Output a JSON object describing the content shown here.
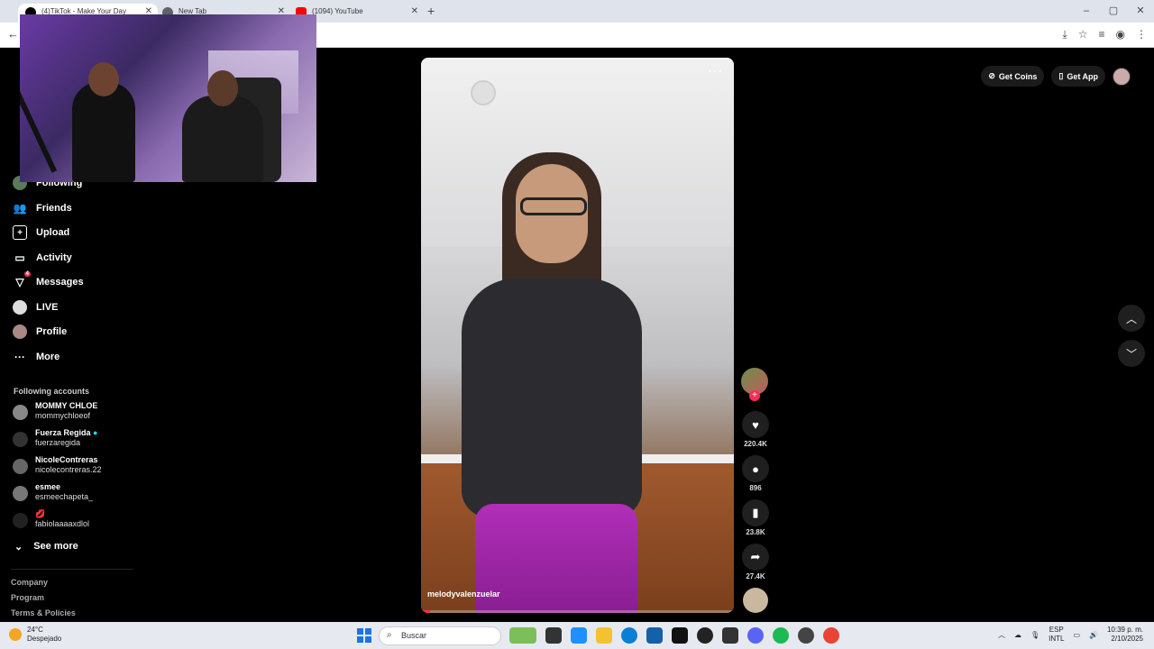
{
  "browser": {
    "tabs": [
      {
        "title": "(4)TikTok - Make Your Day",
        "active": true,
        "favicon_color": "#000000"
      },
      {
        "title": "New Tab",
        "active": false,
        "favicon_color": "#5f6368"
      },
      {
        "title": "(1094) YouTube",
        "active": false,
        "favicon_color": "#ff0000"
      }
    ],
    "new_tab_label": "+",
    "window_controls": [
      "–",
      "▢",
      "✕"
    ]
  },
  "sidebar": {
    "items": [
      {
        "label": "Following",
        "icon": "following-icon"
      },
      {
        "label": "Friends",
        "icon": "friends-icon"
      },
      {
        "label": "Upload",
        "icon": "upload-icon"
      },
      {
        "label": "Activity",
        "icon": "activity-icon"
      },
      {
        "label": "Messages",
        "icon": "messages-icon",
        "badge": "4"
      },
      {
        "label": "LIVE",
        "icon": "live-icon"
      },
      {
        "label": "Profile",
        "icon": "profile-icon"
      },
      {
        "label": "More",
        "icon": "more-icon"
      }
    ],
    "following_title": "Following accounts",
    "accounts": [
      {
        "name": "MOMMY CHLOE",
        "handle": "mommychloeof"
      },
      {
        "name": "Fuerza Regida",
        "handle": "fuerzaregida",
        "verified": true
      },
      {
        "name": "NicoleContreras",
        "handle": "nicolecontreras.22"
      },
      {
        "name": "esmee",
        "handle": "esmeechapeta_"
      },
      {
        "name": "💋",
        "handle": "fabiolaaaaxdlol"
      }
    ],
    "see_more": "See more",
    "footer": [
      "Company",
      "Program",
      "Terms & Policies"
    ]
  },
  "video": {
    "username": "melodyvalenzuelar",
    "menu": "···",
    "progress": 0.03
  },
  "actions": {
    "likes": "220.4K",
    "comments": "896",
    "saves": "23.8K",
    "shares": "27.4K"
  },
  "header": {
    "get_coins": "Get Coins",
    "get_app": "Get App"
  },
  "taskbar": {
    "temperature": "24°C",
    "weather": "Despejado",
    "search_placeholder": "Buscar",
    "lang_line1": "ESP",
    "lang_line2": "INTL",
    "time": "10:39 p. m.",
    "date": "2/10/2025"
  }
}
